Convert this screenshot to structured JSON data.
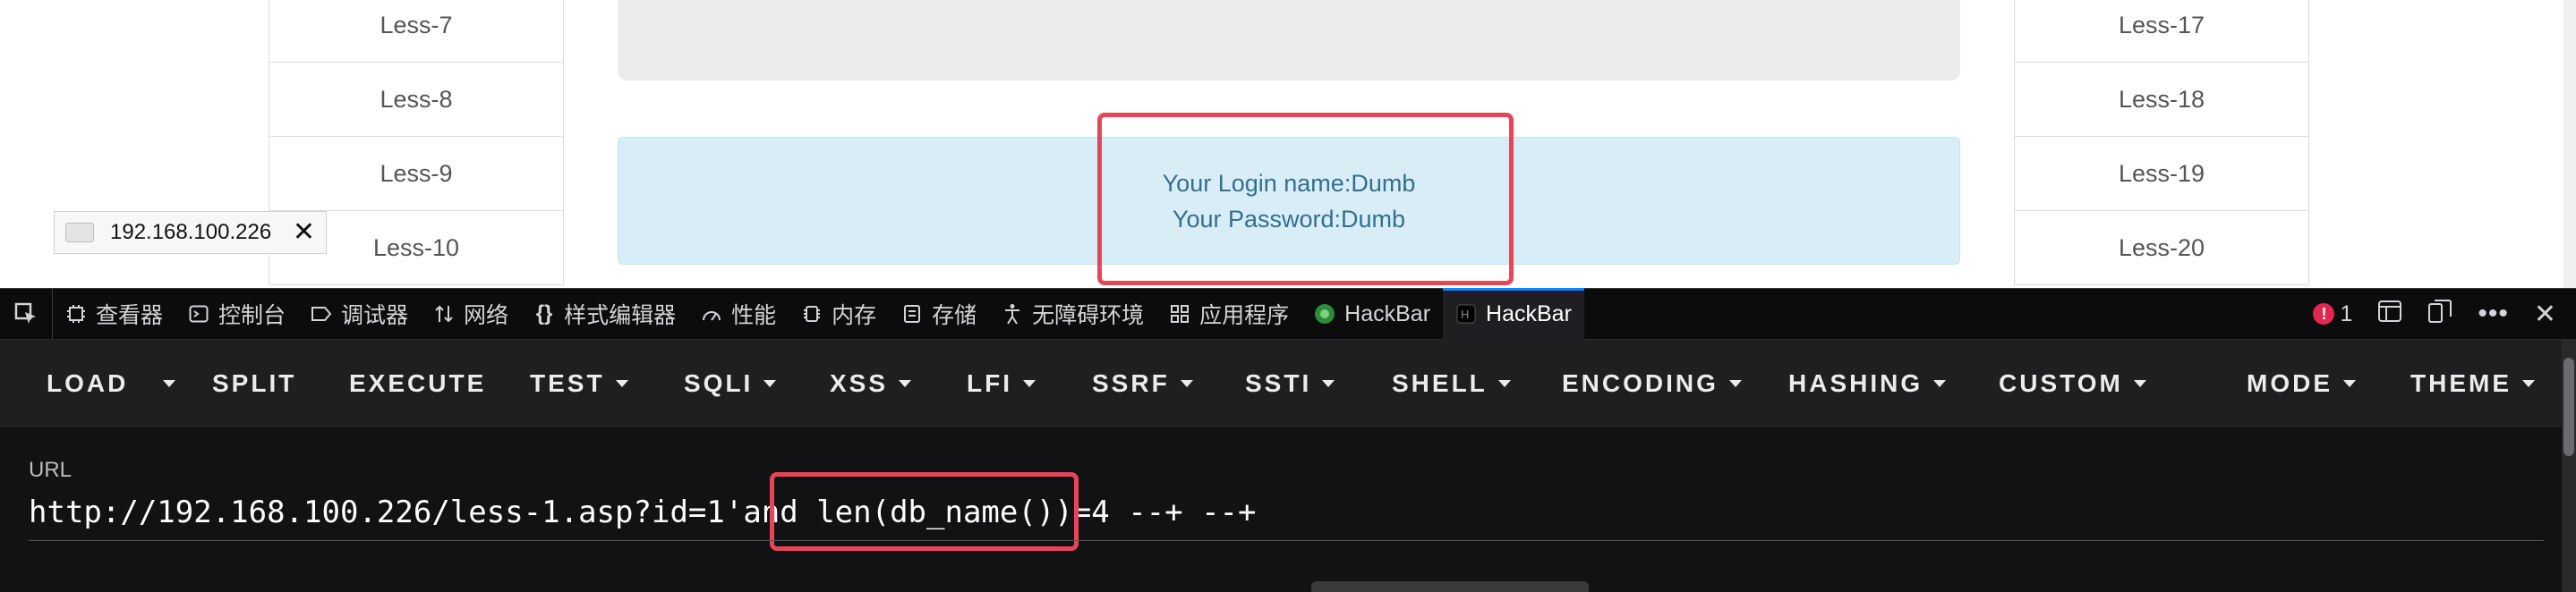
{
  "page": {
    "left_list": [
      "Less-7",
      "Less-8",
      "Less-9",
      "Less-10"
    ],
    "right_list": [
      "Less-17",
      "Less-18",
      "Less-19",
      "Less-20"
    ],
    "login_line": "Your Login name:Dumb",
    "password_line": "Your Password:Dumb",
    "tooltip_ip": "192.168.100.226"
  },
  "devtools": {
    "tabs": [
      {
        "label": "查看器",
        "icon": "inspector-icon"
      },
      {
        "label": "控制台",
        "icon": "console-icon"
      },
      {
        "label": "调试器",
        "icon": "debugger-icon"
      },
      {
        "label": "网络",
        "icon": "network-icon"
      },
      {
        "label": "样式编辑器",
        "icon": "style-editor-icon"
      },
      {
        "label": "性能",
        "icon": "performance-icon"
      },
      {
        "label": "内存",
        "icon": "memory-icon"
      },
      {
        "label": "存储",
        "icon": "storage-icon"
      },
      {
        "label": "无障碍环境",
        "icon": "accessibility-icon"
      },
      {
        "label": "应用程序",
        "icon": "application-icon"
      },
      {
        "label": "HackBar",
        "icon": "hackbar-green-icon"
      },
      {
        "label": "HackBar",
        "icon": "hackbar-dark-icon",
        "active": true
      }
    ],
    "error_count": "1"
  },
  "hackbar": {
    "buttons": [
      "LOAD",
      "SPLIT",
      "EXECUTE",
      "TEST",
      "SQLI",
      "XSS",
      "LFI",
      "SSRF",
      "SSTI",
      "SHELL",
      "ENCODING",
      "HASHING",
      "CUSTOM",
      "MODE",
      "THEME"
    ],
    "url_label": "URL",
    "url_prefix": "http://192.168.100.226/less-1.asp?id=1'and ",
    "url_highlight": "len(db_name())=4",
    "url_suffix": " --+ --+"
  },
  "colors": {
    "highlight": "#e8455a",
    "alert_bg": "#d9edf7",
    "alert_text": "#31708f",
    "active_tab": "#0a84ff"
  }
}
